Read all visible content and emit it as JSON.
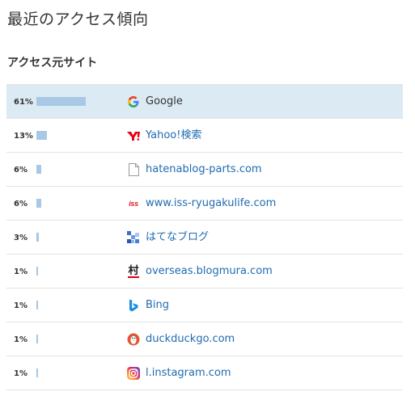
{
  "page_title": "最近のアクセス傾向",
  "section_title": "アクセス元サイト",
  "rows": [
    {
      "percent": "61%",
      "value": 61,
      "site": "Google",
      "icon": "google-icon",
      "active": true
    },
    {
      "percent": "13%",
      "value": 13,
      "site": "Yahoo!検索",
      "icon": "yahoo-icon"
    },
    {
      "percent": "6%",
      "value": 6,
      "site": "hatenablog-parts.com",
      "icon": "document-icon"
    },
    {
      "percent": "6%",
      "value": 6,
      "site": "www.iss-ryugakulife.com",
      "icon": "iss-icon",
      "icon_text": "iss"
    },
    {
      "percent": "3%",
      "value": 3,
      "site": "はてなブログ",
      "icon": "hatena-blog-icon"
    },
    {
      "percent": "1%",
      "value": 1,
      "site": "overseas.blogmura.com",
      "icon": "blogmura-icon",
      "icon_text": "村"
    },
    {
      "percent": "1%",
      "value": 1,
      "site": "Bing",
      "icon": "bing-icon"
    },
    {
      "percent": "1%",
      "value": 1,
      "site": "duckduckgo.com",
      "icon": "duckduckgo-icon"
    },
    {
      "percent": "1%",
      "value": 1,
      "site": "l.instagram.com",
      "icon": "instagram-icon"
    }
  ],
  "colors": {
    "bar": "#a8c8e6",
    "active_row": "#dcebf3",
    "link": "#1f6bb0"
  }
}
